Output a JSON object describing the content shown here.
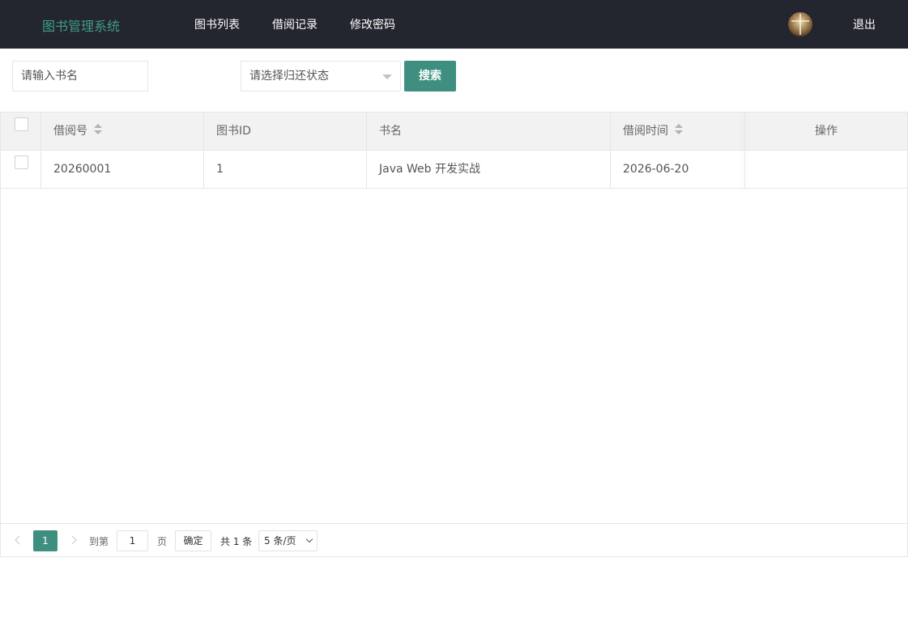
{
  "header": {
    "logo": "图书管理系统",
    "nav": [
      "图书列表",
      "借阅记录",
      "修改密码"
    ],
    "logout": "退出",
    "avatar_icon": "user-avatar-icon"
  },
  "toolbar": {
    "book_name_placeholder": "请输入书名",
    "status_placeholder": "请选择归还状态",
    "search_label": "搜索"
  },
  "table": {
    "columns": [
      "借阅号",
      "图书ID",
      "书名",
      "借阅时间",
      "操作"
    ],
    "rows": [
      {
        "borrow_no": "20260001",
        "book_id": "1",
        "title": "Java Web 开发实战",
        "borrow_time": "2026-06-20",
        "actions": ""
      }
    ]
  },
  "pagination": {
    "current": "1",
    "goto_prefix": "到第",
    "goto_value": "1",
    "goto_suffix": "页",
    "confirm": "确定",
    "total": "共 1 条",
    "page_size": "5 条/页"
  },
  "colors": {
    "header_bg": "#23262e",
    "accent": "#3f8f80",
    "logo": "#3f9c8b"
  }
}
